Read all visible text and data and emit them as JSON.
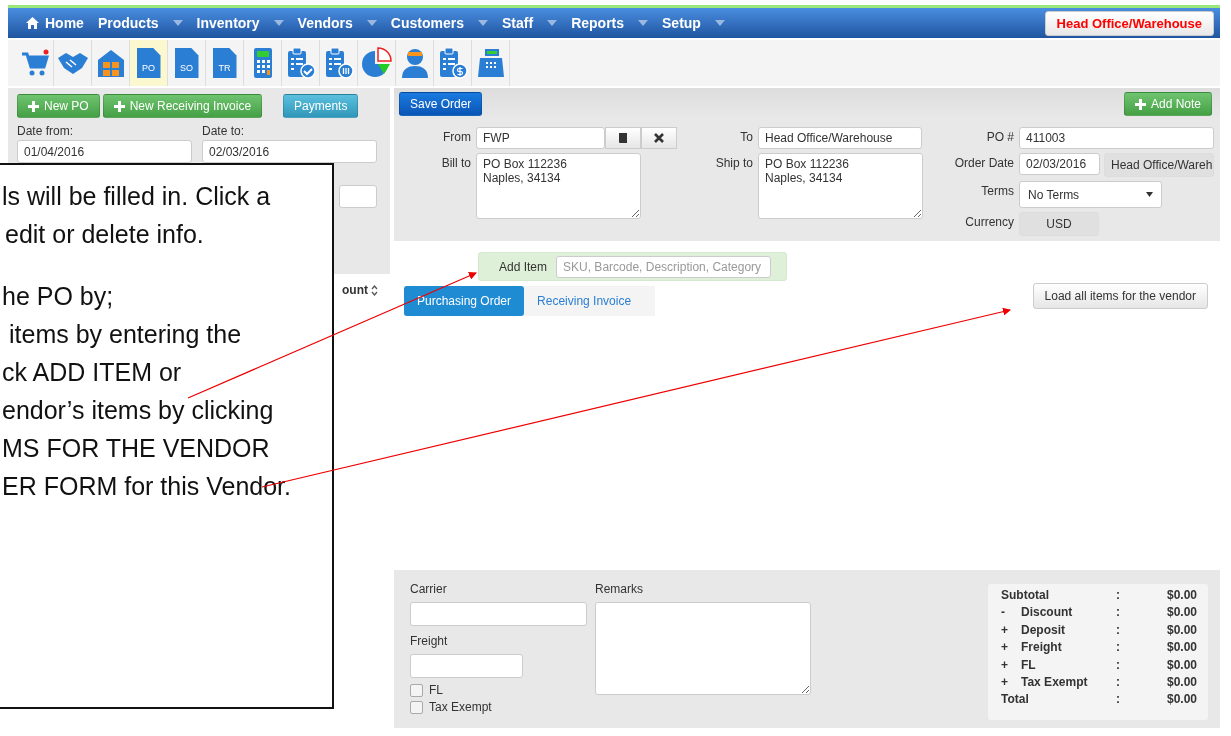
{
  "nav": {
    "home": "Home",
    "menus": [
      "Products",
      "Inventory",
      "Vendors",
      "Customers",
      "Staff",
      "Reports",
      "Setup"
    ],
    "location": "Head Office/Warehouse"
  },
  "toolbar": [
    {
      "kind": "cart",
      "selected": false
    },
    {
      "kind": "handshake",
      "selected": false
    },
    {
      "kind": "warehouse",
      "selected": false
    },
    {
      "kind": "doc",
      "label": "PO",
      "selected": true
    },
    {
      "kind": "doc",
      "label": "SO",
      "selected": false
    },
    {
      "kind": "doc",
      "label": "TR",
      "selected": false
    },
    {
      "kind": "calculator",
      "selected": false
    },
    {
      "kind": "clip-check",
      "selected": false
    },
    {
      "kind": "clip-pause",
      "selected": false
    },
    {
      "kind": "pie",
      "selected": false
    },
    {
      "kind": "person",
      "selected": false
    },
    {
      "kind": "clip-dollar",
      "selected": false
    },
    {
      "kind": "register",
      "selected": false
    }
  ],
  "sidebar": {
    "buttons": [
      {
        "label": "New PO",
        "kind": "add"
      },
      {
        "label": "New Receiving Invoice",
        "kind": "add"
      },
      {
        "label": "Payments",
        "kind": "info"
      }
    ],
    "date_from": {
      "label": "Date from:",
      "value": "01/04/2016"
    },
    "date_to": {
      "label": "Date to:",
      "value": "02/03/2016"
    },
    "column_header": "ount"
  },
  "order": {
    "save": "Save Order",
    "add_note": "Add Note",
    "from": {
      "label": "From",
      "value": "FWP"
    },
    "to": {
      "label": "To",
      "value": "Head Office/Warehouse"
    },
    "po_number": {
      "label": "PO #",
      "value": "411003"
    },
    "bill_to": {
      "label": "Bill to",
      "value": "PO Box 112236\nNaples, 34134"
    },
    "ship_to": {
      "label": "Ship to",
      "value": "PO Box 112236\nNaples, 34134"
    },
    "order_date": {
      "label": "Order Date",
      "value": "02/03/2016",
      "location": "Head Office/Wareh"
    },
    "terms": {
      "label": "Terms",
      "value": "No Terms"
    },
    "currency": {
      "label": "Currency",
      "value": "USD"
    },
    "add_item": {
      "label": "Add Item",
      "placeholder": "SKU, Barcode, Description, Category"
    },
    "tabs": [
      {
        "label": "Purchasing Order",
        "selected": true
      },
      {
        "label": "Receiving Invoice",
        "selected": false
      }
    ],
    "load_all": "Load all items for the vendor"
  },
  "footer": {
    "carrier": "Carrier",
    "freight": "Freight",
    "remarks": "Remarks",
    "checkboxes": [
      {
        "label": "FL",
        "checked": false
      },
      {
        "label": "Tax Exempt",
        "checked": false
      }
    ],
    "totals": [
      {
        "label": "Subtotal",
        "colon": ":",
        "value": "$0.00"
      },
      {
        "sign": "-",
        "label": "Discount",
        "colon": ":",
        "value": "$0.00"
      },
      {
        "sign": "+",
        "label": "Deposit",
        "colon": ":",
        "value": "$0.00"
      },
      {
        "sign": "+",
        "label": "Freight",
        "colon": ":",
        "value": "$0.00"
      },
      {
        "sign": "+",
        "label": "FL",
        "colon": ":",
        "value": "$0.00"
      },
      {
        "sign": "+",
        "label": "Tax Exempt",
        "colon": ":",
        "value": "$0.00"
      },
      {
        "label": "Total",
        "colon": ":",
        "value": "$0.00"
      }
    ]
  },
  "callout": {
    "lines": [
      "ls will be filled in. Click a",
      "edit or delete info.",
      "he PO by;",
      "items by entering the",
      "ck ADD ITEM or",
      "endor’s items by clicking",
      "MS FOR THE VENDOR",
      "ER FORM for this Vendor."
    ]
  }
}
